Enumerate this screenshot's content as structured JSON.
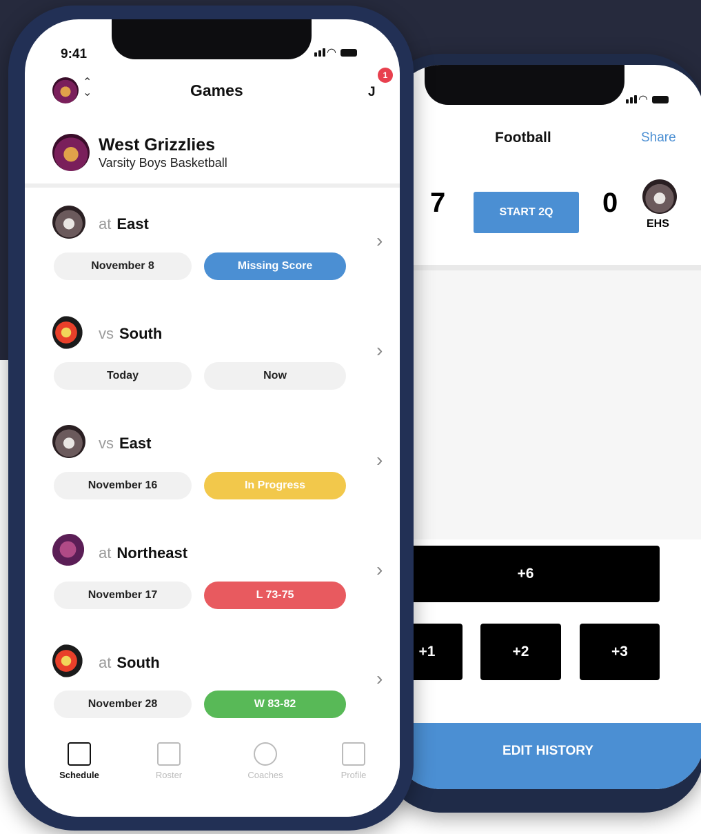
{
  "colors": {
    "background": "#262a3d",
    "phone_frame": "#223055",
    "accent_blue": "#4b8fd3",
    "in_progress": "#f2c84b",
    "loss": "#e85a5f",
    "win": "#58b957"
  },
  "front": {
    "status_time": "9:41",
    "header": {
      "title": "Games",
      "user_initial": "J",
      "notification_count": "1"
    },
    "team": {
      "name": "West Grizzlies",
      "subtitle": "Varsity Boys Basketball"
    },
    "games": [
      {
        "prefix": "at",
        "opponent": "East",
        "date": "November 8",
        "status": "Missing Score",
        "status_color": "#4b8fd3",
        "logo": "wolf-logo"
      },
      {
        "prefix": "vs",
        "opponent": "South",
        "date": "Today",
        "status": "Now",
        "status_color": "#f1f1f1",
        "logo": "eagle-logo"
      },
      {
        "prefix": "vs",
        "opponent": "East",
        "date": "November 16",
        "status": "In Progress",
        "status_color": "#f2c84b",
        "logo": "wolf-logo"
      },
      {
        "prefix": "at",
        "opponent": "Northeast",
        "date": "November 17",
        "status": "L 73-75",
        "status_color": "#e85a5f",
        "logo": "horse-logo"
      },
      {
        "prefix": "at",
        "opponent": "South",
        "date": "November 28",
        "status": "W 83-82",
        "status_color": "#58b957",
        "logo": "eagle-logo"
      }
    ],
    "tabs": [
      {
        "label": "Schedule",
        "icon": "calendar-icon",
        "active": true
      },
      {
        "label": "Roster",
        "icon": "roster-icon",
        "active": false
      },
      {
        "label": "Coaches",
        "icon": "whistle-icon",
        "active": false
      },
      {
        "label": "Profile",
        "icon": "edit-icon",
        "active": false
      }
    ]
  },
  "back": {
    "header": {
      "title": "Football",
      "share_label": "Share"
    },
    "score": {
      "home": "7",
      "away": "0",
      "start_label": "START 2Q",
      "away_abbr": "EHS"
    },
    "buttons": {
      "plus6": "+6",
      "plus1": "+1",
      "plus2": "+2",
      "plus3": "+3"
    },
    "edit_history_label": "EDIT HISTORY"
  }
}
